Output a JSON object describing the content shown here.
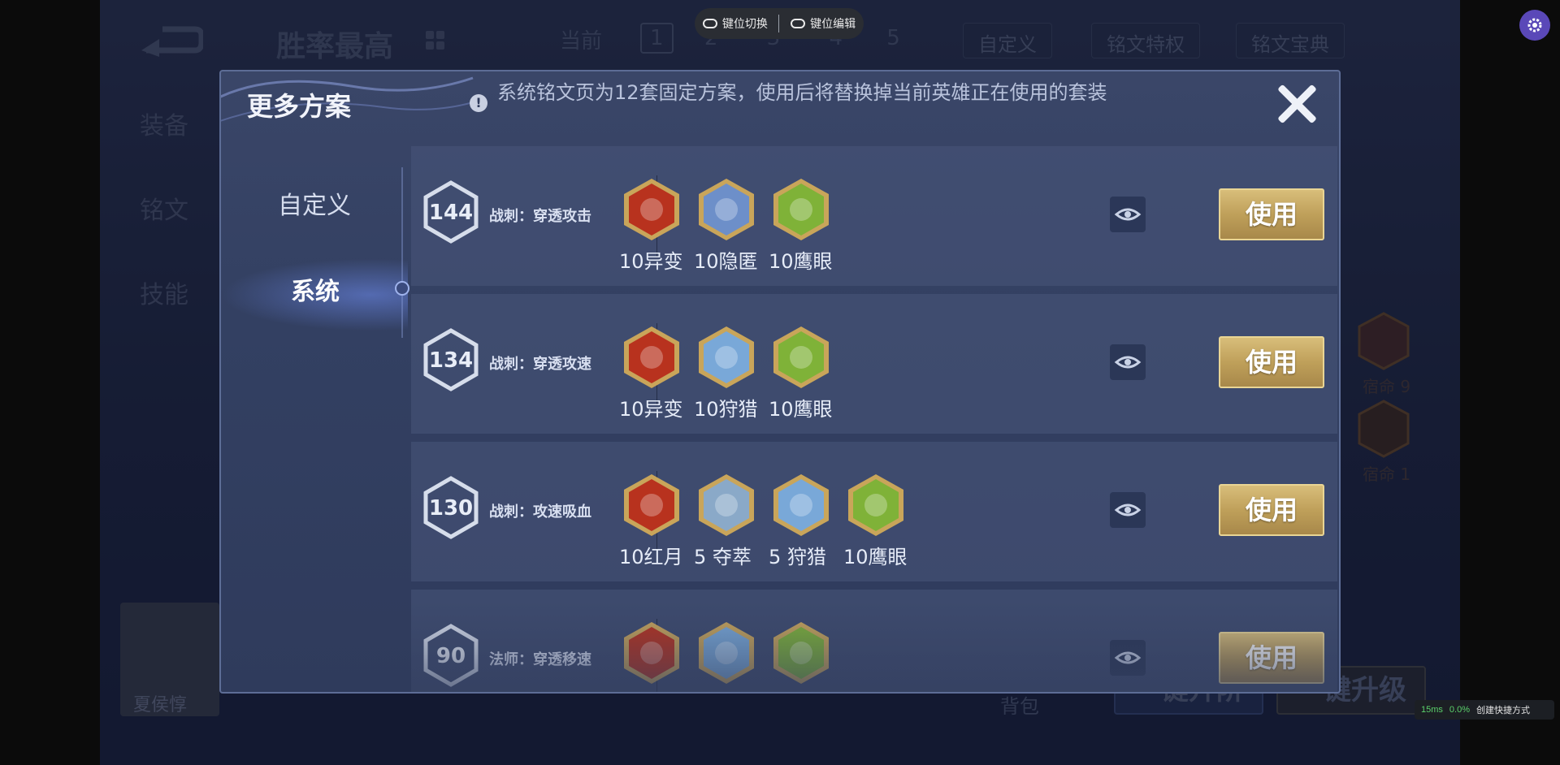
{
  "background": {
    "title": "胜率最高",
    "page_tabs": {
      "current_label": "当前",
      "pages": [
        "1",
        "2",
        "3",
        "4",
        "5"
      ]
    },
    "custom_button": "自定义",
    "privilege_button": "铭文特权",
    "treasure_button": "铭文宝典",
    "left_nav": [
      "装备",
      "铭文",
      "技能"
    ],
    "hero_name": "夏侯惇",
    "bag_label": "背包",
    "one_key_level_btn": "一键升级",
    "one_key_craft_btn": "一键升阶",
    "side_runes": [
      {
        "label": "宿命 9"
      },
      {
        "label": "宿命 1"
      }
    ]
  },
  "toolbar": {
    "key_switch": "键位切换",
    "key_edit": "键位编辑"
  },
  "status": {
    "latency": "15ms",
    "percent": "0.0%",
    "shortcut": "创建快捷方式"
  },
  "dialog": {
    "title": "更多方案",
    "notice": "系统铭文页为12套固定方案，使用后将替换掉当前英雄正在使用的套装",
    "tabs": {
      "custom": "自定义",
      "system": "系统"
    },
    "use_label": "使用",
    "plans": [
      {
        "score": "144",
        "name": "战刺：穿透攻击",
        "runes": [
          {
            "label": "10异变",
            "icon": "red-rune-icon",
            "color": "#b8321e"
          },
          {
            "label": "10隐匿",
            "icon": "blue-rune-icon",
            "color": "#6d8fc9"
          },
          {
            "label": "10鹰眼",
            "icon": "green-rune-icon",
            "color": "#7fb238"
          }
        ]
      },
      {
        "score": "134",
        "name": "战刺：穿透攻速",
        "runes": [
          {
            "label": "10异变",
            "icon": "red-rune-icon",
            "color": "#b8321e"
          },
          {
            "label": "10狩猎",
            "icon": "blue-rune-icon",
            "color": "#79a8d8"
          },
          {
            "label": "10鹰眼",
            "icon": "green-rune-icon",
            "color": "#7fb238"
          }
        ]
      },
      {
        "score": "130",
        "name": "战刺：攻速吸血",
        "runes": [
          {
            "label": "10红月",
            "icon": "red-rune-icon",
            "color": "#b8321e"
          },
          {
            "label": "5 夺萃",
            "icon": "blue-rune-icon",
            "color": "#8aa9c8"
          },
          {
            "label": "5 狩猎",
            "icon": "blue-rune-icon",
            "color": "#79a8d8"
          },
          {
            "label": "10鹰眼",
            "icon": "green-rune-icon",
            "color": "#7fb238"
          }
        ]
      },
      {
        "score": "90",
        "name": "法师：穿透移速",
        "runes": [
          {
            "label": "",
            "icon": "red-rune-icon",
            "color": "#b8321e"
          },
          {
            "label": "",
            "icon": "blue-rune-icon",
            "color": "#79a8d8"
          },
          {
            "label": "",
            "icon": "green-rune-icon",
            "color": "#7fb238"
          }
        ]
      }
    ]
  },
  "colors": {
    "gold_button": "#c9ac66",
    "dialog_bg": "#334062",
    "accent_purple": "#5a48b8"
  }
}
